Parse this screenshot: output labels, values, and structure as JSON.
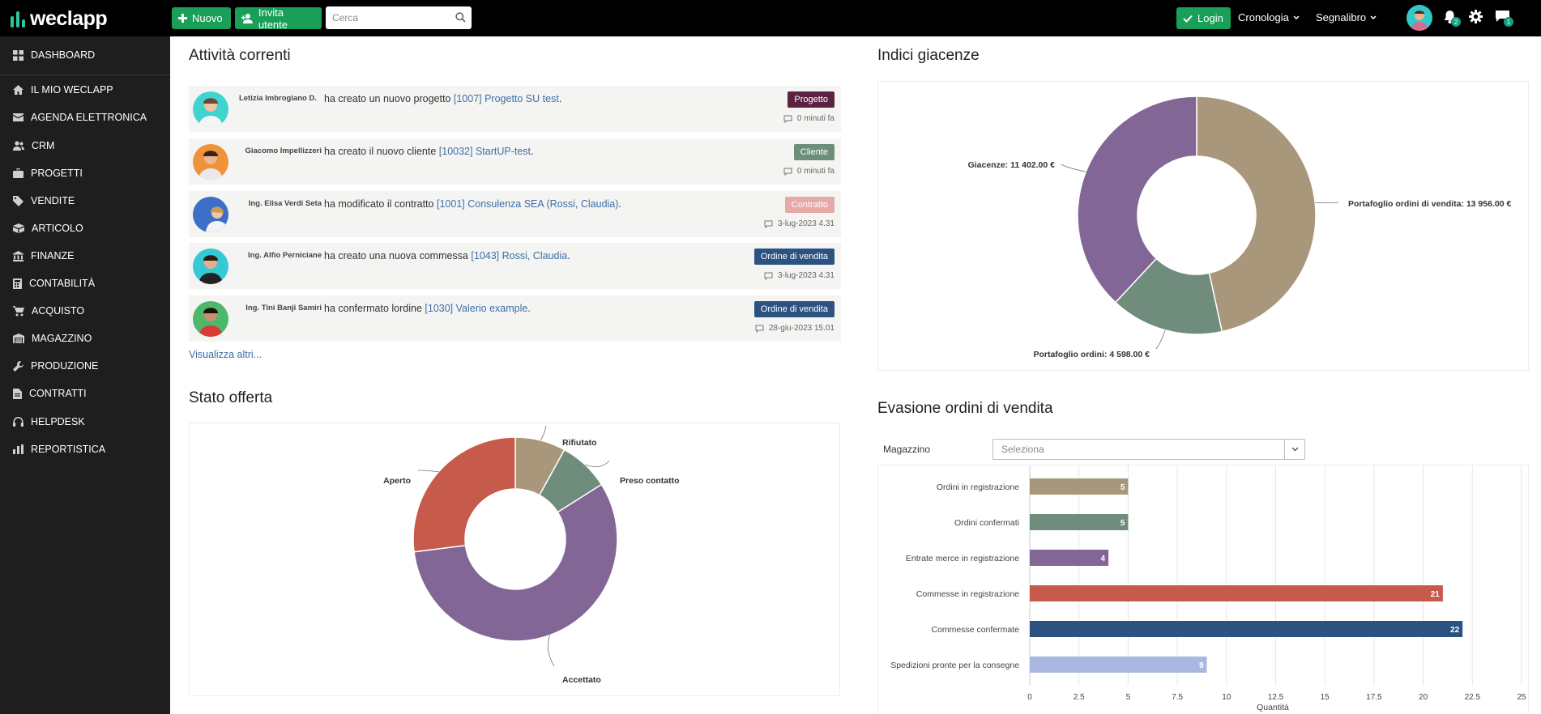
{
  "app": {
    "logo_text": "weclapp",
    "brand_color": "#2cc5a0"
  },
  "topbar": {
    "new_label": "Nuovo",
    "invite_label": "Invita utente",
    "search_placeholder": "Cerca",
    "login_label": "Login",
    "history_label": "Cronologia",
    "bookmarks_label": "Segnalibro",
    "notifications_count": "2",
    "messages_count": "1"
  },
  "sidebar": {
    "items": [
      {
        "label": "DASHBOARD",
        "icon": "dashboard-icon"
      },
      {
        "label": "IL MIO WECLAPP",
        "icon": "home-icon"
      },
      {
        "label": "AGENDA ELETTRONICA",
        "icon": "mail-icon"
      },
      {
        "label": "CRM",
        "icon": "users-icon"
      },
      {
        "label": "PROGETTI",
        "icon": "briefcase-icon"
      },
      {
        "label": "VENDITE",
        "icon": "tag-icon"
      },
      {
        "label": "ARTICOLO",
        "icon": "box-icon"
      },
      {
        "label": "FINANZE",
        "icon": "bank-icon"
      },
      {
        "label": "CONTABILITÀ",
        "icon": "calculator-icon"
      },
      {
        "label": "ACQUISTO",
        "icon": "cart-icon"
      },
      {
        "label": "MAGAZZINO",
        "icon": "warehouse-icon"
      },
      {
        "label": "PRODUZIONE",
        "icon": "wrench-icon"
      },
      {
        "label": "CONTRATTI",
        "icon": "document-icon"
      },
      {
        "label": "HELPDESK",
        "icon": "headset-icon"
      },
      {
        "label": "REPORTISTICA",
        "icon": "bar-chart-icon"
      }
    ]
  },
  "activities": {
    "title": "Attività correnti",
    "more_label": "Visualizza altri...",
    "items": [
      {
        "user": "Letizia Imbrogiano D.",
        "action": "ha creato un nuovo progetto",
        "link": "[1007] Progetto SU test",
        "suffix": ".",
        "tag": "Progetto",
        "tag_color": "#5b2241",
        "time": "0 minuti fa",
        "avatar_color": "#3fd4d0"
      },
      {
        "user": "Giacomo Impellizzeri",
        "action": "ha creato il nuovo cliente",
        "link": "[10032] StartUP-test",
        "suffix": ".",
        "tag": "Cliente",
        "tag_color": "#6b8f7a",
        "time": "0 minuti fa",
        "avatar_color": "#f0923a"
      },
      {
        "user": "Ing. Elisa Verdi Seta",
        "action": "ha modificato il contratto",
        "link": "[1001] Consulenza SEA (Rossi, Claudia)",
        "suffix": ".",
        "tag": "Contratto",
        "tag_color": "#e5a9a6",
        "time": "3-lug-2023 4.31",
        "avatar_color": "#3d6fc9"
      },
      {
        "user": "Ing. Alfio Perniciane",
        "action": "ha creato una nuova commessa",
        "link": "[1043] Rossi, Claudia",
        "suffix": ".",
        "tag": "Ordine di vendita",
        "tag_color": "#2c5282",
        "time": "3-lug-2023 4.31",
        "avatar_color": "#35c9d6"
      },
      {
        "user": "Ing. Tini Banji Samiri",
        "action": "ha confermato lordine",
        "link": "[1030] Valerio example",
        "suffix": ".",
        "tag": "Ordine di vendita",
        "tag_color": "#2c5282",
        "time": "28-giu-2023 15.01",
        "avatar_color": "#4db86a"
      }
    ]
  },
  "offer_status": {
    "title": "Stato offerta"
  },
  "stock_index": {
    "title": "Indici giacenze"
  },
  "order_fulfillment": {
    "title": "Evasione ordini di vendita",
    "warehouse_label": "Magazzino",
    "warehouse_placeholder": "Seleziona"
  },
  "chart_data": [
    {
      "type": "pie",
      "donut": true,
      "title": "Stato offerta",
      "slices": [
        {
          "label": "Rifiutato",
          "value": 8,
          "color": "#a8977a"
        },
        {
          "label": "Preso contatto",
          "value": 8,
          "color": "#6f8c7c"
        },
        {
          "label": "Accettato",
          "value": 57,
          "color": "#826796"
        },
        {
          "label": "Aperto",
          "value": 27,
          "color": "#c65a4b"
        }
      ]
    },
    {
      "type": "pie",
      "donut": true,
      "title": "Indici giacenze",
      "slices": [
        {
          "label": "Portafoglio ordini di vendita: 13 956.00 €",
          "value": 13956,
          "color": "#a8977a"
        },
        {
          "label": "Portafoglio ordini: 4 598.00 €",
          "value": 4598,
          "color": "#6f8c7c"
        },
        {
          "label": "Giacenze: 11 402.00 €",
          "value": 11402,
          "color": "#826796"
        }
      ]
    },
    {
      "type": "bar",
      "orientation": "horizontal",
      "title": "Evasione ordini di vendita",
      "xlabel": "Quantità",
      "xlim": [
        0,
        25
      ],
      "xticks": [
        "0",
        "2.5",
        "5",
        "7.5",
        "10",
        "12.5",
        "15",
        "17.5",
        "20",
        "22.5",
        "25"
      ],
      "grid": true,
      "categories": [
        "Ordini in registrazione",
        "Ordini confermati",
        "Entrate merce in registrazione",
        "Commesse in registrazione",
        "Commesse confermate",
        "Spedizioni pronte per la consegne"
      ],
      "values": [
        5,
        5,
        4,
        21,
        22,
        9
      ],
      "colors": [
        "#a8977a",
        "#6f8c7c",
        "#826796",
        "#c65a4b",
        "#2c5282",
        "#a9b8e0"
      ]
    }
  ]
}
